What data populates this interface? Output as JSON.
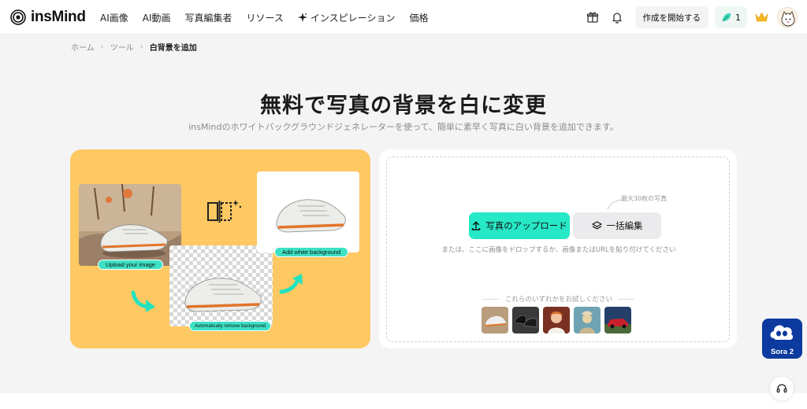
{
  "header": {
    "logo_text": "insMind",
    "nav": [
      {
        "label": "AI画像"
      },
      {
        "label": "AI動画"
      },
      {
        "label": "写真編集者"
      },
      {
        "label": "リソース"
      },
      {
        "label": "インスピレーション",
        "icon": "sparkle-icon"
      },
      {
        "label": "価格"
      }
    ],
    "icons": [
      "gift-icon",
      "bell-icon"
    ],
    "create_label": "作成を開始する",
    "credits": "1"
  },
  "breadcrumb": {
    "home": "ホーム",
    "tools": "ツール",
    "current": "白背景を追加"
  },
  "hero": {
    "title": "無料で写真の背景を白に変更",
    "subtitle": "insMindのホワイトバックグラウンドジェネレーターを使って、簡単に素早く写真に白い背景を追加できます。"
  },
  "illustration": {
    "upload_label": "Upload your image",
    "remove_label": "Automatically remove background",
    "add_white_label": "Add white background"
  },
  "upload": {
    "max_note": "最大30枚の写真",
    "upload_button": "写真のアップロード",
    "batch_button": "一括編集",
    "drop_hint": "または、ここに画像をドロップするか、画像またはURLを貼り付けてください",
    "try_label": "これらのいずれかをお試しください",
    "samples": [
      "shoe-sample",
      "sneakers-sample",
      "portrait-sample",
      "painting-sample",
      "car-sample"
    ]
  },
  "floating": {
    "sora_label": "Sora 2"
  },
  "colors": {
    "accent": "#26e8c6",
    "illustration_bg": "#fec862",
    "sora_bg": "#0c3a9e"
  }
}
